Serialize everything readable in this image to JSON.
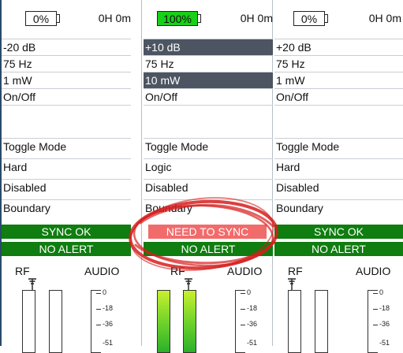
{
  "columns": [
    {
      "battery": "0%",
      "battery_level": 0,
      "time": "0H 0m",
      "gain": "-20 dB",
      "freq": "75 Hz",
      "power": "1 mW",
      "switch": "On/Off",
      "blank": "",
      "mode": "Toggle Mode",
      "lock": "Hard",
      "state": "Disabled",
      "boundary": "Boundary",
      "sync": "SYNC OK",
      "alert": "NO ALERT",
      "rf": "RF",
      "audio": "AUDIO",
      "rf_level": 0,
      "ticks": [
        "0",
        "-18",
        "-36",
        "-51"
      ]
    },
    {
      "battery": "100%",
      "battery_level": 1.0,
      "time": "0H 0m",
      "gain": "+10 dB",
      "freq": "75 Hz",
      "power": "10 mW",
      "switch": "On/Off",
      "blank": "",
      "mode": "Toggle Mode",
      "lock": "Logic",
      "state": "Disabled",
      "boundary": "Boundary",
      "sync": "NEED TO SYNC",
      "alert": "NO ALERT",
      "rf": "RF",
      "audio": "AUDIO",
      "rf_level": 1.0,
      "ticks": [
        "0",
        "-18",
        "-36",
        "-51"
      ]
    },
    {
      "battery": "0%",
      "battery_level": 0,
      "time": "0H 0m",
      "gain": "+20 dB",
      "freq": "75 Hz",
      "power": "1 mW",
      "switch": "On/Off",
      "blank": "",
      "mode": "Toggle Mode",
      "lock": "Hard",
      "state": "Disabled",
      "boundary": "Boundary",
      "sync": "SYNC OK",
      "alert": "NO ALERT",
      "rf": "RF",
      "audio": "AUDIO",
      "rf_level": 0,
      "ticks": [
        "0",
        "-18",
        "-36",
        "-51"
      ]
    }
  ],
  "colors": {
    "sync_ok": "#0f7d0f",
    "need_sync": "#f26b6b",
    "selected_row": "#4d5562",
    "battery_full": "#18d018",
    "stamp": "#d61e1e"
  },
  "icons": [
    "battery-icon",
    "antenna-icon",
    "need-sync-stamp"
  ]
}
